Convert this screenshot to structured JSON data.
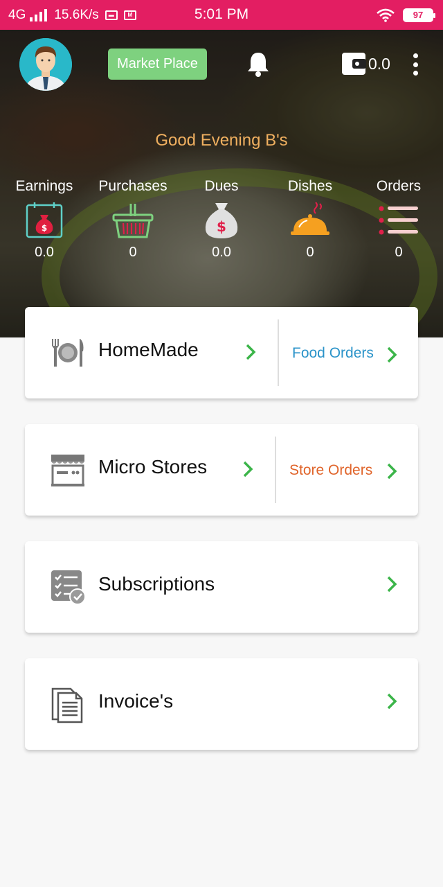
{
  "status_bar": {
    "network": "4G",
    "speed": "15.6K/s",
    "time": "5:01 PM",
    "battery": "97"
  },
  "header": {
    "market_place_label": "Market Place",
    "wallet_balance": "0.0",
    "greeting": "Good Evening B's"
  },
  "stats": [
    {
      "label": "Earnings",
      "value": "0.0",
      "icon": "money-bag-calendar-icon"
    },
    {
      "label": "Purchases",
      "value": "0",
      "icon": "basket-icon"
    },
    {
      "label": "Dues",
      "value": "0.0",
      "icon": "dollar-bag-icon"
    },
    {
      "label": "Dishes",
      "value": "0",
      "icon": "cloche-icon"
    },
    {
      "label": "Orders",
      "value": "0",
      "icon": "list-icon"
    }
  ],
  "cards": {
    "homemade": {
      "title": "HomeMade",
      "sub_label": "Food Orders",
      "icon": "plate-cutlery-icon"
    },
    "micro_stores": {
      "title": "Micro Stores",
      "sub_label": "Store Orders",
      "icon": "storefront-icon"
    },
    "subscriptions": {
      "title": "Subscriptions",
      "icon": "checklist-icon"
    },
    "invoices": {
      "title": "Invoice's",
      "icon": "documents-icon"
    }
  },
  "colors": {
    "status_bar": "#e31e62",
    "market_button": "#7ed17f",
    "greeting": "#f0b060",
    "chevron": "#3cb54a",
    "food_orders": "#2a93c9",
    "store_orders": "#e0642a"
  }
}
